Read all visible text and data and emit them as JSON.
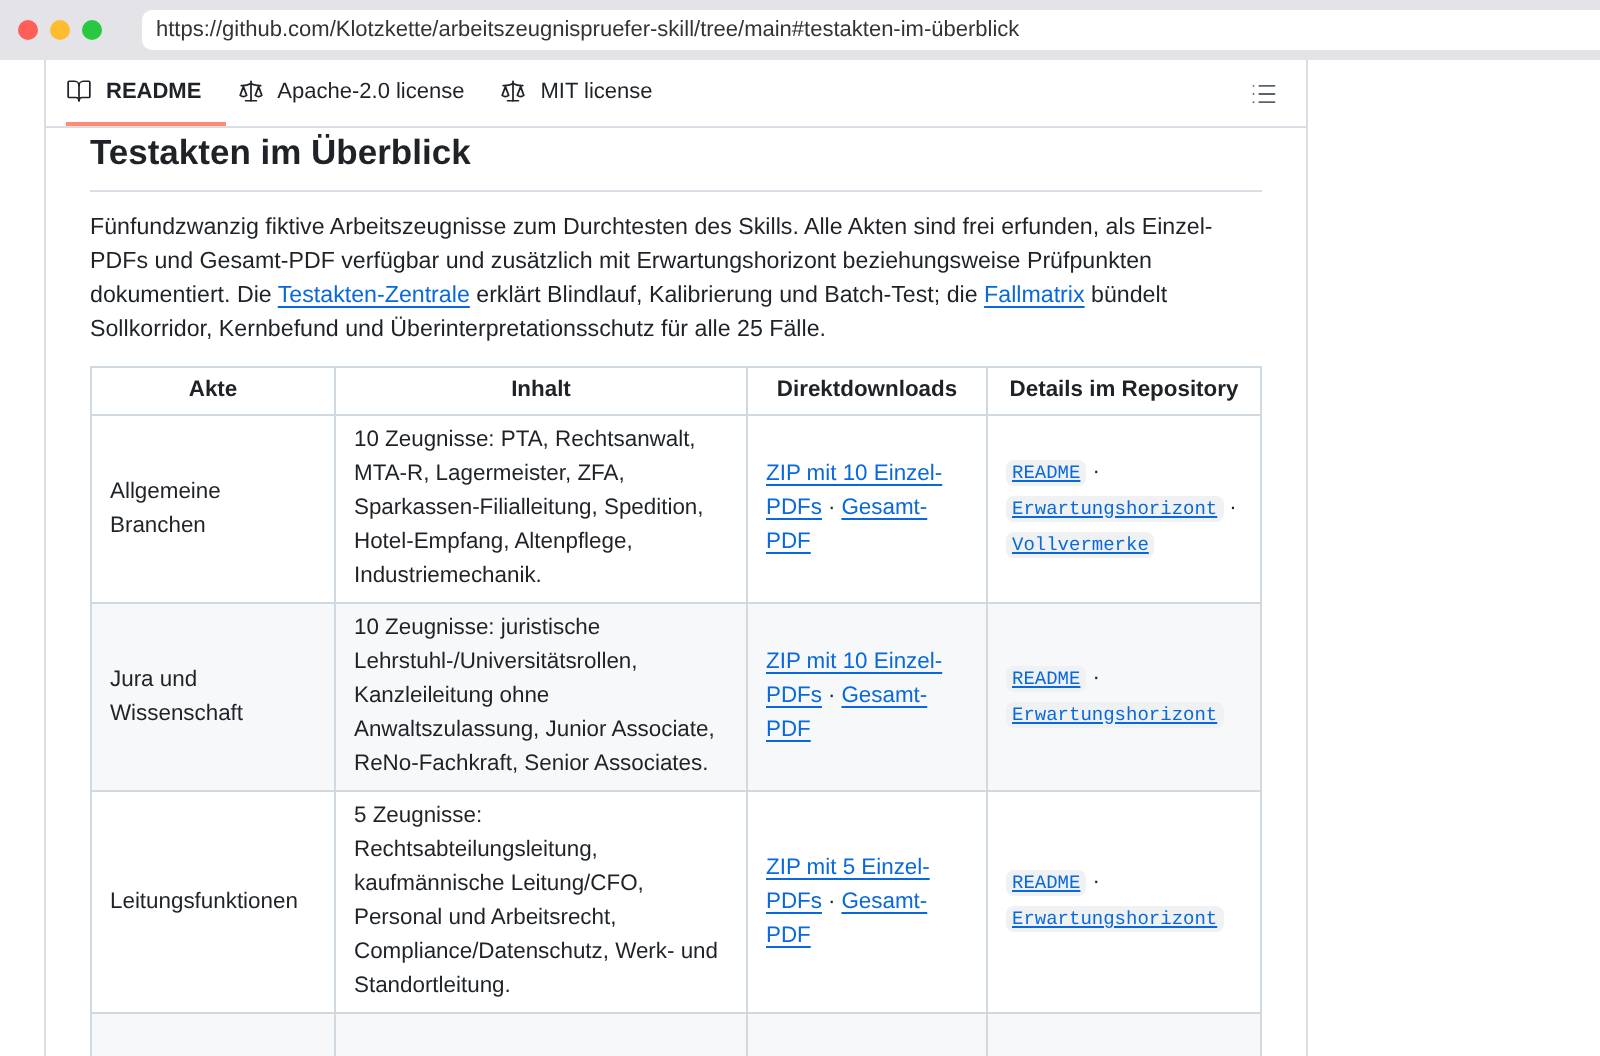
{
  "browser": {
    "url": "https://github.com/Klotzkette/arbeitszeugnispruefer-skill/tree/main#testakten-im-überblick"
  },
  "tabs": [
    {
      "label": "README",
      "kind": "book",
      "selected": true
    },
    {
      "label": "Apache-2.0 license",
      "kind": "scale",
      "selected": false
    },
    {
      "label": "MIT license",
      "kind": "scale",
      "selected": false
    }
  ],
  "heading": "Testakten im Überblick",
  "intro": [
    {
      "kind": "text",
      "text": "Fünfundzwanzig fiktive Arbeitszeugnisse zum Durchtesten des Skills. Alle Akten sind frei erfunden, als Einzel-PDFs und Gesamt-PDF verfügbar und zusätzlich mit Erwartungshorizont beziehungsweise Prüfpunkten dokumentiert. Die "
    },
    {
      "kind": "link",
      "text": "Testakten-Zentrale"
    },
    {
      "kind": "text",
      "text": " erklärt Blindlauf, Kalibrierung und Batch-Test; die "
    },
    {
      "kind": "link",
      "text": "Fallmatrix"
    },
    {
      "kind": "text",
      "text": " bündelt Sollkorridor, Kernbefund und Überinterpretationsschutz für alle 25 Fälle."
    }
  ],
  "table": {
    "separator": "·",
    "columns": [
      "Akte",
      "Inhalt",
      "Direktdownloads",
      "Details im Repository"
    ],
    "rows": [
      {
        "akte": "Allgemeine Branchen",
        "inhalt": "10 Zeugnisse: PTA, Rechtsanwalt, MTA-R, Lagermeister, ZFA, Sparkassen-Filialleitung, Spedition, Hotel-Empfang, Altenpflege, Industriemechanik.",
        "downloads": [
          "ZIP mit 10 Einzel-PDFs",
          "Gesamt-PDF"
        ],
        "details": [
          "README",
          "Erwartungshorizont",
          "Vollvermerke"
        ]
      },
      {
        "akte": "Jura und Wissenschaft",
        "inhalt": "10 Zeugnisse: juristische Lehrstuhl-/Universitätsrollen, Kanzleileitung ohne Anwaltszulassung, Junior Associate, ReNo-Fachkraft, Senior Associates.",
        "downloads": [
          "ZIP mit 10 Einzel-PDFs",
          "Gesamt-PDF"
        ],
        "details": [
          "README",
          "Erwartungshorizont"
        ]
      },
      {
        "akte": "Leitungsfunktionen",
        "inhalt": "5 Zeugnisse: Rechtsabteilungsleitung, kaufmännische Leitung/CFO, Personal und Arbeitsrecht, Compliance/Datenschutz, Werk- und Standortleitung.",
        "downloads": [
          "ZIP mit 5 Einzel-PDFs",
          "Gesamt-PDF"
        ],
        "details": [
          "README",
          "Erwartungshorizont"
        ]
      }
    ]
  }
}
